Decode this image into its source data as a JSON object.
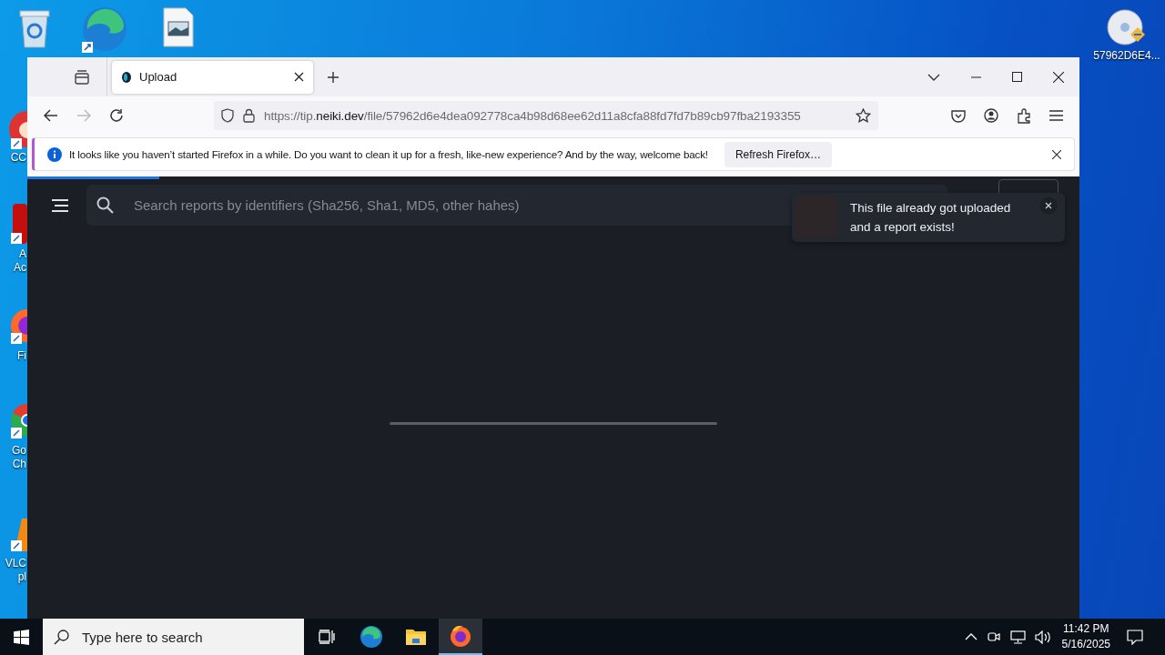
{
  "desktop": {
    "icons": [
      {
        "kind": "recycle"
      },
      {
        "kind": "edge"
      },
      {
        "kind": "image"
      },
      {
        "kind": "ccleaner",
        "lines": [
          "CC"
        ]
      },
      {
        "kind": "acrobat",
        "lines": [
          "A",
          "Ac"
        ]
      },
      {
        "kind": "firefox",
        "lines": [
          "Fi"
        ]
      },
      {
        "kind": "chrome",
        "lines": [
          "Go",
          "Ch"
        ]
      },
      {
        "kind": "vlc",
        "lines": [
          "VLC",
          "pl"
        ]
      },
      {
        "kind": "disc",
        "lines": [
          "57962D6E4..."
        ]
      }
    ]
  },
  "browser": {
    "tabs": [
      {
        "title": "Upload",
        "selected": true
      }
    ],
    "url": {
      "prefix": "https://tip.",
      "host": "neiki.dev",
      "path": "/file/57962d6e4dea092778ca4b98d68ee62d11a8cfa88fd7fd7b89cb97fba2193355"
    },
    "forward_disabled": true,
    "infobar": {
      "message": "It looks like you haven’t started Firefox in a while. Do you want to clean it up for a fresh, like-new experience? And by the way, welcome back!",
      "button": "Refresh Firefox…"
    },
    "page_loading": {
      "level": 0.125
    },
    "search": {
      "placeholder": "Search reports by identifiers (Sha256, Sha1, MD5, other hahes)"
    },
    "toast": {
      "message": "This file already got uploaded and a report exists!"
    }
  },
  "taskbar": {
    "search_placeholder": "Type here to search",
    "apps": [
      {
        "kind": "taskview",
        "selected": false
      },
      {
        "kind": "edge",
        "selected": false
      },
      {
        "kind": "explorer",
        "selected": false
      },
      {
        "kind": "firefox",
        "selected": true
      }
    ],
    "time": "11:42 PM",
    "date": "5/16/2025"
  }
}
